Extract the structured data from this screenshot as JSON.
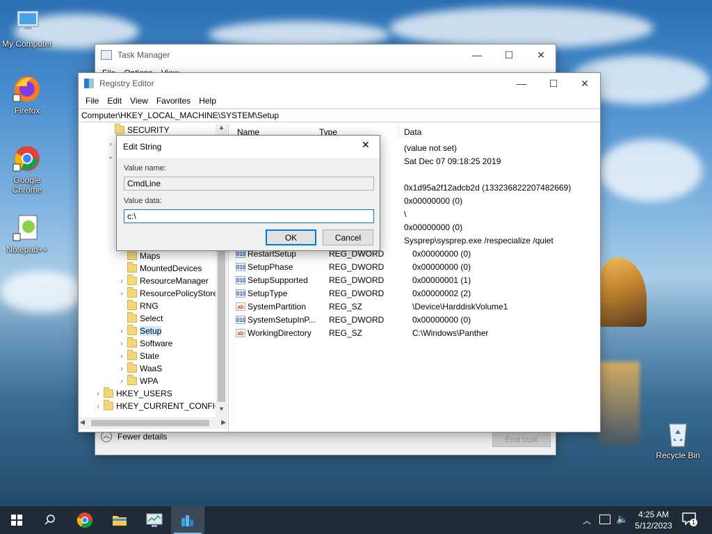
{
  "desktop": {
    "icons": [
      {
        "label": "My Computer"
      },
      {
        "label": "Firefox"
      },
      {
        "label": "Google Chrome"
      },
      {
        "label": "Notepad++"
      },
      {
        "label": "Recycle Bin"
      }
    ]
  },
  "task_manager": {
    "title": "Task Manager",
    "menu": [
      "File",
      "Options",
      "View"
    ],
    "fewer_details": "Fewer details",
    "end_task": "End task"
  },
  "registry_editor": {
    "title": "Registry Editor",
    "menu": [
      "File",
      "Edit",
      "View",
      "Favorites",
      "Help"
    ],
    "address": "Computer\\HKEY_LOCAL_MACHINE\\SYSTEM\\Setup",
    "tree": [
      {
        "label": "SECURITY",
        "chevron": ""
      },
      {
        "label": "Maps",
        "chevron": ""
      },
      {
        "label": "MountedDevices",
        "chevron": ""
      },
      {
        "label": "ResourceManager",
        "chevron": "›"
      },
      {
        "label": "ResourcePolicyStore",
        "chevron": "›"
      },
      {
        "label": "RNG",
        "chevron": ""
      },
      {
        "label": "Select",
        "chevron": ""
      },
      {
        "label": "Setup",
        "chevron": "›"
      },
      {
        "label": "Software",
        "chevron": "›"
      },
      {
        "label": "State",
        "chevron": "›"
      },
      {
        "label": "WaaS",
        "chevron": "›"
      },
      {
        "label": "WPA",
        "chevron": "›"
      },
      {
        "label": "HKEY_USERS",
        "chevron": "›"
      },
      {
        "label": "HKEY_CURRENT_CONFIG",
        "chevron": "›"
      }
    ],
    "columns": {
      "name": "Name",
      "type": "Type",
      "data": "Data"
    },
    "values": [
      {
        "icon": "",
        "name": "",
        "type": "",
        "data": "(value not set)"
      },
      {
        "icon": "",
        "name": "",
        "type": "",
        "data": "Sat Dec 07 09:18:25 2019"
      },
      {
        "icon": "",
        "name": "",
        "type": "",
        "data": "0x1d95a2f12adcb2d (133236822207482669)"
      },
      {
        "icon": "",
        "name": "",
        "type": "",
        "data": "0x00000000 (0)"
      },
      {
        "icon": "",
        "name": "",
        "type": "",
        "data": "\\"
      },
      {
        "icon": "",
        "name": "",
        "type": "",
        "data": "0x00000000 (0)"
      },
      {
        "icon": "",
        "name": "",
        "type": "",
        "data": "Sysprep\\sysprep.exe /respecialize /quiet"
      },
      {
        "icon": "dw",
        "name": "RestartSetup",
        "type": "REG_DWORD",
        "data": "0x00000000 (0)"
      },
      {
        "icon": "dw",
        "name": "SetupPhase",
        "type": "REG_DWORD",
        "data": "0x00000000 (0)"
      },
      {
        "icon": "dw",
        "name": "SetupSupported",
        "type": "REG_DWORD",
        "data": "0x00000001 (1)"
      },
      {
        "icon": "dw",
        "name": "SetupType",
        "type": "REG_DWORD",
        "data": "0x00000002 (2)"
      },
      {
        "icon": "sz",
        "name": "SystemPartition",
        "type": "REG_SZ",
        "data": "\\Device\\HarddiskVolume1"
      },
      {
        "icon": "dw",
        "name": "SystemSetupInP...",
        "type": "REG_DWORD",
        "data": "0x00000000 (0)"
      },
      {
        "icon": "sz",
        "name": "WorkingDirectory",
        "type": "REG_SZ",
        "data": "C:\\Windows\\Panther"
      }
    ]
  },
  "edit_string_dialog": {
    "title": "Edit String",
    "value_name_label": "Value name:",
    "value_name": "CmdLine",
    "value_data_label": "Value data:",
    "value_data": "c:\\",
    "ok": "OK",
    "cancel": "Cancel"
  },
  "taskbar": {
    "time": "4:25 AM",
    "date": "5/12/2023",
    "notification_count": "1"
  }
}
